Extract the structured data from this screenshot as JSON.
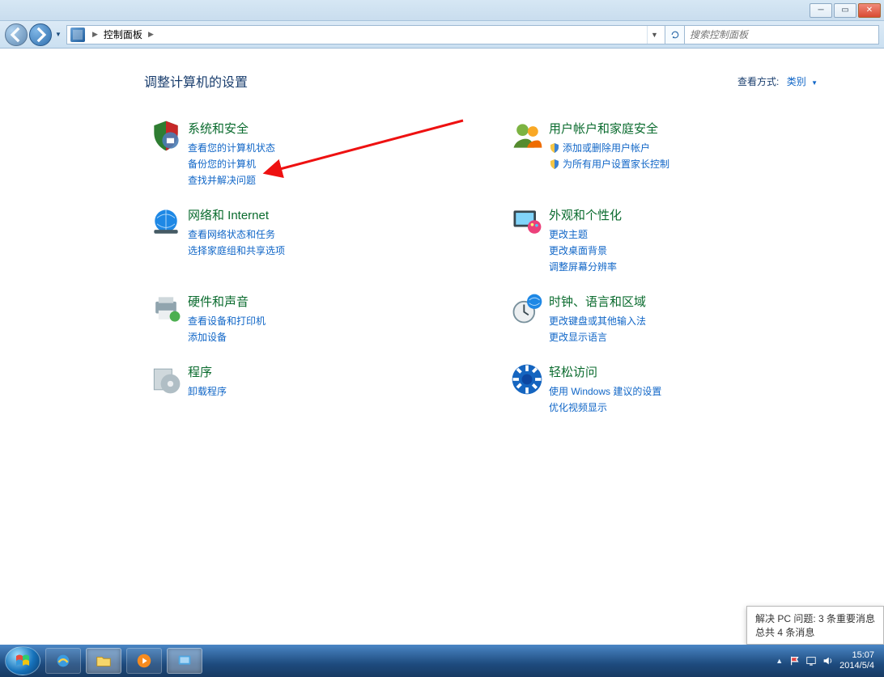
{
  "window": {
    "breadcrumb": "控制面板",
    "search_placeholder": "搜索控制面板"
  },
  "page": {
    "title": "调整计算机的设置",
    "view_by_label": "查看方式:",
    "view_by_value": "类别"
  },
  "categories": [
    {
      "heading": "系统和安全",
      "links": [
        {
          "label": "查看您的计算机状态",
          "shield": false
        },
        {
          "label": "备份您的计算机",
          "shield": false
        },
        {
          "label": "查找并解决问题",
          "shield": false
        }
      ]
    },
    {
      "heading": "用户帐户和家庭安全",
      "links": [
        {
          "label": "添加或删除用户帐户",
          "shield": true
        },
        {
          "label": "为所有用户设置家长控制",
          "shield": true
        }
      ]
    },
    {
      "heading": "网络和 Internet",
      "links": [
        {
          "label": "查看网络状态和任务",
          "shield": false
        },
        {
          "label": "选择家庭组和共享选项",
          "shield": false
        }
      ]
    },
    {
      "heading": "外观和个性化",
      "links": [
        {
          "label": "更改主题",
          "shield": false
        },
        {
          "label": "更改桌面背景",
          "shield": false
        },
        {
          "label": "调整屏幕分辨率",
          "shield": false
        }
      ]
    },
    {
      "heading": "硬件和声音",
      "links": [
        {
          "label": "查看设备和打印机",
          "shield": false
        },
        {
          "label": "添加设备",
          "shield": false
        }
      ]
    },
    {
      "heading": "时钟、语言和区域",
      "links": [
        {
          "label": "更改键盘或其他输入法",
          "shield": false
        },
        {
          "label": "更改显示语言",
          "shield": false
        }
      ]
    },
    {
      "heading": "程序",
      "links": [
        {
          "label": "卸载程序",
          "shield": false
        }
      ]
    },
    {
      "heading": "轻松访问",
      "links": [
        {
          "label": "使用 Windows 建议的设置",
          "shield": false
        },
        {
          "label": "优化视频显示",
          "shield": false
        }
      ]
    }
  ],
  "notification": {
    "line1": "解决 PC 问题:  3 条重要消息",
    "line2": "总共 4 条消息"
  },
  "taskbar": {
    "time": "15:07",
    "date": "2014/5/4"
  }
}
